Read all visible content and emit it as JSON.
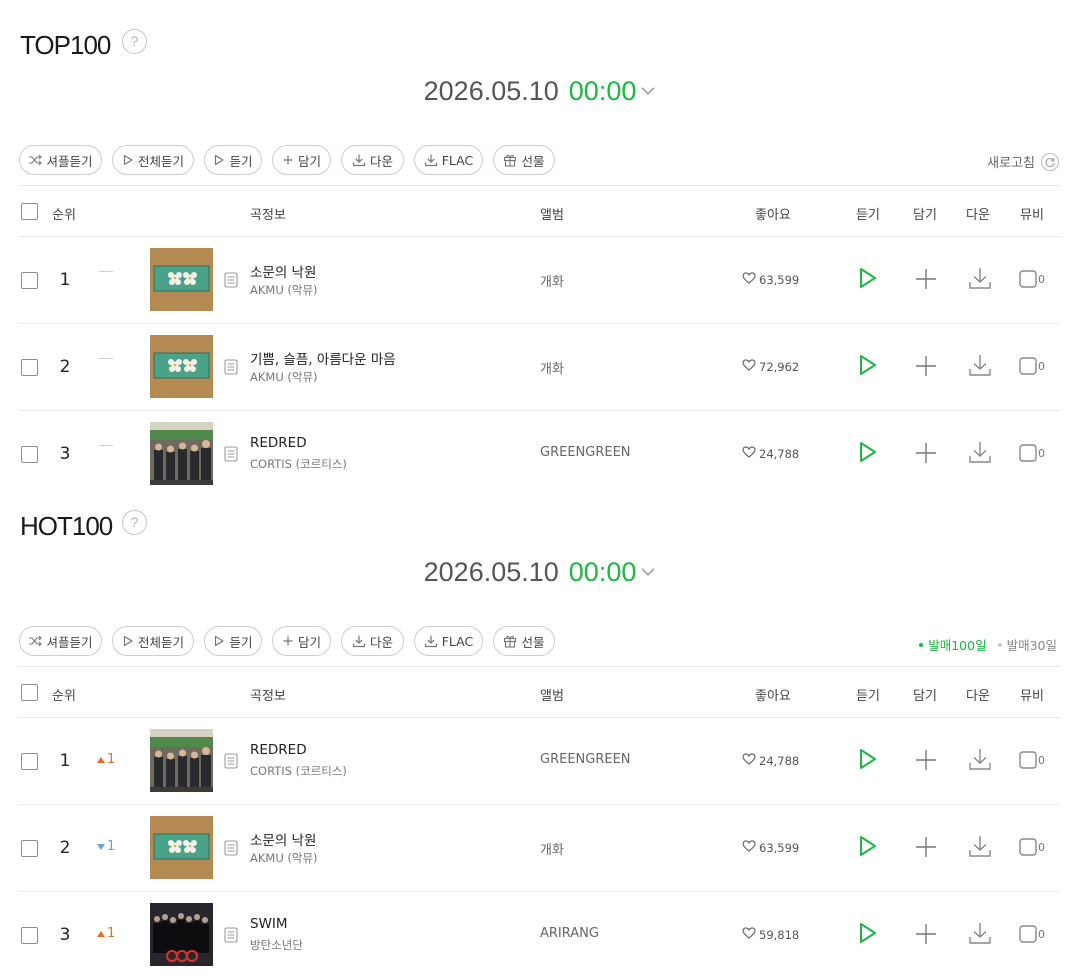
{
  "top100": {
    "title": "TOP100",
    "help": "?",
    "date": "2026.05.10",
    "time": "00:00",
    "toolbar": {
      "shuffle": "셔플듣기",
      "play_all": "전체듣기",
      "play": "듣기",
      "add": "담기",
      "download": "다운",
      "flac": "FLAC",
      "gift": "선물"
    },
    "refresh": "새로고침",
    "headers": {
      "rank": "순위",
      "song": "곡정보",
      "album": "앨범",
      "likes": "좋아요",
      "play": "듣기",
      "add": "담기",
      "down": "다운",
      "mv": "뮤비"
    },
    "rows": [
      {
        "rank": "1",
        "change": "",
        "title": "소문의 낙원",
        "artist": "AKMU (악뮤)",
        "album": "개화",
        "likes": "63,599",
        "mv": "0"
      },
      {
        "rank": "2",
        "change": "",
        "title": "기쁨, 슬픔, 아름다운 마음",
        "artist": "AKMU (악뮤)",
        "album": "개화",
        "likes": "72,962",
        "mv": "0"
      },
      {
        "rank": "3",
        "change": "",
        "title": "REDRED",
        "artist": "CORTIS (코르티스)",
        "album": "GREENGREEN",
        "likes": "24,788",
        "mv": "0"
      }
    ]
  },
  "hot100": {
    "title": "HOT100",
    "help": "?",
    "date": "2026.05.10",
    "time": "00:00",
    "toolbar": {
      "shuffle": "셔플듣기",
      "play_all": "전체듣기",
      "play": "듣기",
      "add": "담기",
      "download": "다운",
      "flac": "FLAC",
      "gift": "선물"
    },
    "period_on": "발매100일",
    "period_off": "발매30일",
    "headers": {
      "rank": "순위",
      "song": "곡정보",
      "album": "앨범",
      "likes": "좋아요",
      "play": "듣기",
      "add": "담기",
      "down": "다운",
      "mv": "뮤비"
    },
    "rows": [
      {
        "rank": "1",
        "change": "1",
        "title": "REDRED",
        "artist": "CORTIS (코르티스)",
        "album": "GREENGREEN",
        "likes": "24,788",
        "mv": "0"
      },
      {
        "rank": "2",
        "change": "1",
        "title": "소문의 낙원",
        "artist": "AKMU (악뮤)",
        "album": "개화",
        "likes": "63,599",
        "mv": "0"
      },
      {
        "rank": "3",
        "change": "1",
        "title": "SWIM",
        "artist": "방탄소년단",
        "album": "ARIRANG",
        "likes": "59,818",
        "mv": "0"
      }
    ]
  },
  "colors": {
    "accent": "#1cb83f",
    "up": "#e86d1b",
    "down": "#5aa7e0"
  },
  "icons": [
    "help-icon",
    "chevron-down-icon",
    "shuffle-icon",
    "play-icon",
    "plus-icon",
    "download-icon",
    "gift-icon",
    "refresh-icon",
    "heart-icon",
    "lyrics-icon",
    "video-icon"
  ]
}
